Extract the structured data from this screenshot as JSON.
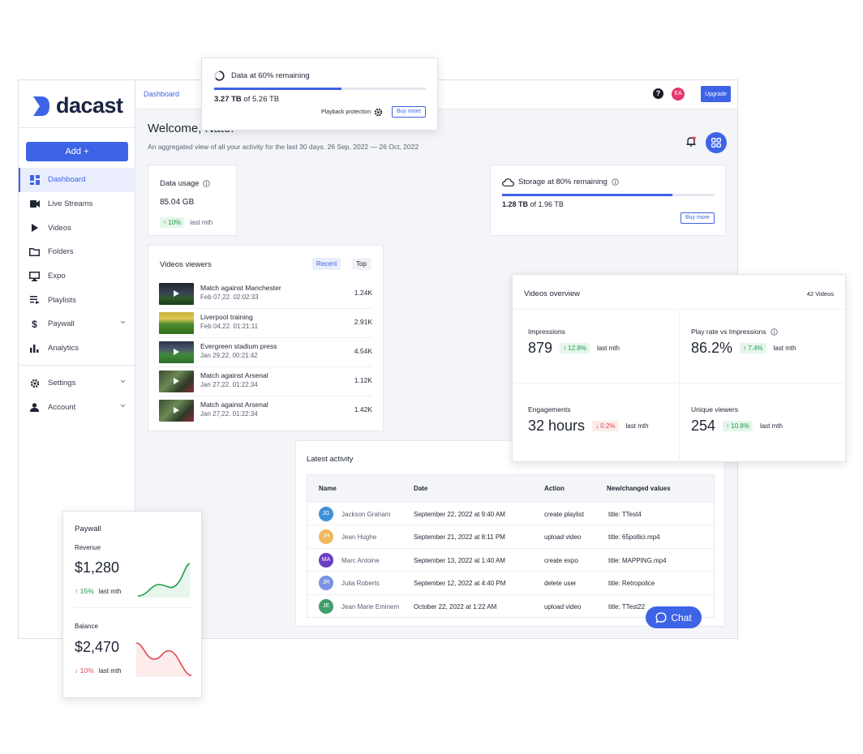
{
  "app": {
    "logo_text": "dacast",
    "add_label": "Add +",
    "nav": [
      {
        "label": "Dashboard",
        "icon": "dashboard-icon"
      },
      {
        "label": "Live Streams",
        "icon": "camera-icon"
      },
      {
        "label": "Videos",
        "icon": "play-icon"
      },
      {
        "label": "Folders",
        "icon": "folder-icon"
      },
      {
        "label": "Expo",
        "icon": "monitor-icon"
      },
      {
        "label": "Playlists",
        "icon": "playlist-icon"
      },
      {
        "label": "Paywall",
        "icon": "dollar-icon"
      },
      {
        "label": "Analytics",
        "icon": "bar-chart-icon"
      }
    ],
    "nav_bottom": [
      {
        "label": "Settings",
        "icon": "gear-icon"
      },
      {
        "label": "Account",
        "icon": "person-icon"
      }
    ],
    "breadcrumb": "Dashboard",
    "help_icon": "?",
    "user_initials": "EA",
    "upgrade_label": "Upgrade",
    "welcome": "Welcome, Nate!",
    "welcome_sub": "An aggregated view of all your activity for the last 30 days. 26 Sep, 2022 — 26 Oct, 2022"
  },
  "data_usage": {
    "title": "Data usage",
    "value": "85.04 GB",
    "change": "↑ 10%",
    "period": "last mth"
  },
  "storage": {
    "title": "Storage at 80% remaining",
    "value_bold": "1.28 TB",
    "value_rest": " of 1.96 TB",
    "progress": 0.8,
    "buy_label": "Buy more"
  },
  "videos_viewers": {
    "title": "Videos viewers",
    "tab_recent": "Recent",
    "tab_top": "Top",
    "rows": [
      {
        "title": "Match against Manchester",
        "date": "Feb 07,22. 02:02:33",
        "count": "1.24K"
      },
      {
        "title": "Liverpool training",
        "date": "Feb 04,22. 01:21:11",
        "count": "2.91K"
      },
      {
        "title": "Evergreen stadium press",
        "date": "Jan 29,22. 00:21:42",
        "count": "4.54K"
      },
      {
        "title": "Match against Arsenal",
        "date": "Jan 27,22. 01:22:34",
        "count": "1.12K"
      },
      {
        "title": "Match against Arsenal",
        "date": "Jan 27,22. 01:22:34",
        "count": "1.42K"
      }
    ]
  },
  "latest_activity": {
    "title": "Latest activity",
    "columns": [
      "Name",
      "Date",
      "Action",
      "New/changed values"
    ],
    "rows": [
      {
        "initials": "JG",
        "color": "#3f8fd8",
        "name": "Jackson Graham",
        "date": "September 22, 2022 at 9:40 AM",
        "action": "create playlist",
        "value": "title: TTest4"
      },
      {
        "initials": "JH",
        "color": "#f2b85c",
        "name": "Jean Hughe",
        "date": "September 21, 2022 at 8:11 PM",
        "action": "upload video",
        "value": "title: 65pollici.mp4"
      },
      {
        "initials": "MA",
        "color": "#6a3fc4",
        "name": "Marc Antoine",
        "date": "September 13, 2022 at 1:40 AM",
        "action": "create expo",
        "value": "title: MAPPING.mp4"
      },
      {
        "initials": "JR",
        "color": "#7b93e6",
        "name": "Julia Roberts",
        "date": "September 12, 2022 at 4:40 PM",
        "action": "delete user",
        "value": "title: Retropolice"
      },
      {
        "initials": "JE",
        "color": "#3f9e6c",
        "name": "Jean Marie Eminem",
        "date": "October 22, 2022 at 1:22 AM",
        "action": "upload video",
        "value": "title: TTest22"
      }
    ]
  },
  "chat": {
    "label": "Chat"
  },
  "data_popover": {
    "title": "Data at 60% remaining",
    "value_bold": "3.27 TB",
    "value_rest": " of 5.26 TB",
    "progress": 0.6,
    "protection_label": "Playback protection",
    "buy_label": "Buy more"
  },
  "videos_overview": {
    "title": "Videos overview",
    "count": "42 Videos",
    "cells": [
      {
        "label": "Impressions",
        "value": "879",
        "change": "↑ 12.8%",
        "trend": "up",
        "period": "last mth"
      },
      {
        "label": "Play rate vs Impressions",
        "value": "86.2%",
        "change": "↑ 7.4%",
        "trend": "up",
        "period": "last mth"
      },
      {
        "label": "Engagements",
        "value": "32 hours",
        "change": "↓ 0.2%",
        "trend": "down",
        "period": "last mth"
      },
      {
        "label": "Unique viewers",
        "value": "254",
        "change": "↑ 10.8%",
        "trend": "up",
        "period": "last mth"
      }
    ]
  },
  "paywall": {
    "title": "Paywall",
    "revenue_label": "Revenue",
    "revenue_value": "$1,280",
    "revenue_change": "↑ 15%",
    "revenue_period": "last mth",
    "balance_label": "Balance",
    "balance_value": "$2,470",
    "balance_change": "↓ 10%",
    "balance_period": "last mth"
  },
  "colors": {
    "accent": "#3d63e6",
    "up": "#1c9c4c",
    "down": "#e0464f"
  }
}
